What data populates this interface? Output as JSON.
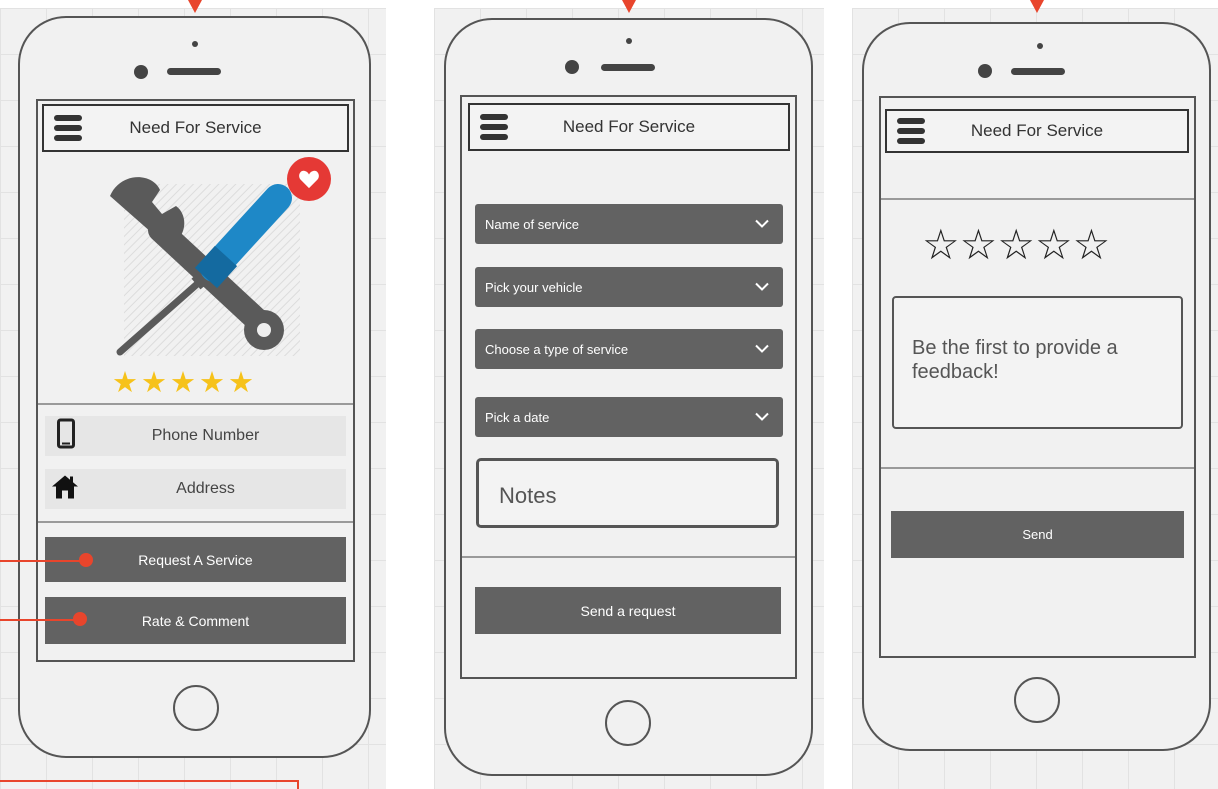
{
  "app": {
    "title": "Need For Service"
  },
  "screen1": {
    "contact": {
      "phone_label": "Phone Number",
      "address_label": "Address"
    },
    "rating": {
      "stars": 5,
      "max": 5
    },
    "actions": {
      "request_label": "Request A Service",
      "rate_label": "Rate & Comment"
    }
  },
  "screen2": {
    "dropdowns": [
      {
        "label": "Name of service"
      },
      {
        "label": "Pick your vehicle"
      },
      {
        "label": "Choose a type of service"
      },
      {
        "label": "Pick a date"
      }
    ],
    "notes_placeholder": "Notes",
    "submit_label": "Send a request"
  },
  "screen3": {
    "rating": {
      "stars": 0,
      "max": 5
    },
    "feedback_text": "Be the first to provide a feedback!",
    "send_label": "Send"
  },
  "colors": {
    "accent": "#e8452c",
    "button": "#626262",
    "star_gold": "#f6c21a",
    "heart_badge": "#e53935",
    "screwdriver_blue": "#1e88c7",
    "wrench_gray": "#5a5a5a"
  },
  "icons": {
    "menu": "hamburger-icon",
    "favorite": "heart-icon",
    "phone": "phone-icon",
    "address": "home-icon",
    "dropdown": "chevron-down-icon"
  }
}
